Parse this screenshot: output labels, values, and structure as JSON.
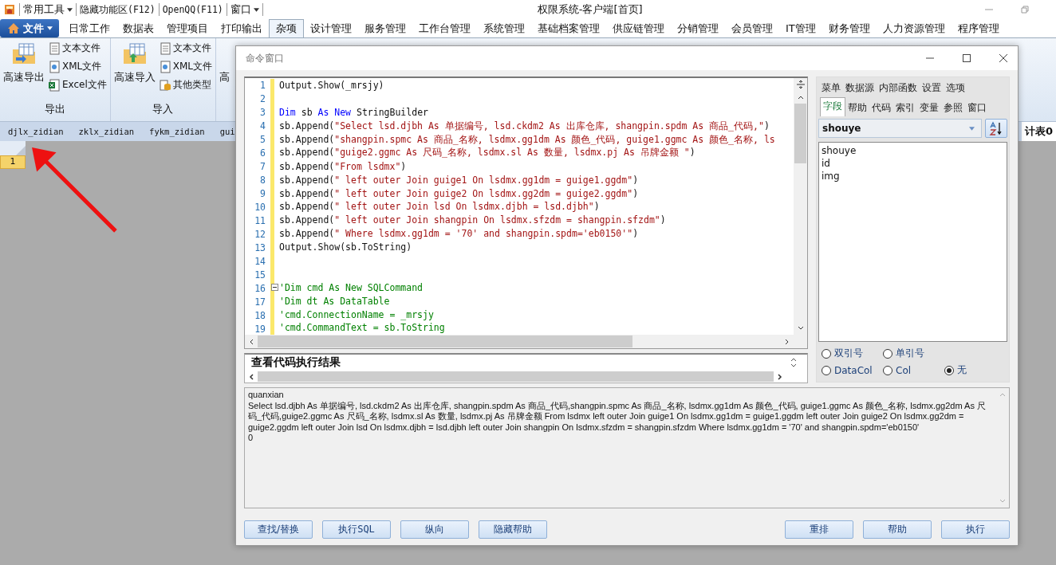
{
  "quick_bar": [
    {
      "label": "常用工具",
      "dropdown": true
    },
    {
      "label": "隐藏功能区(F12)",
      "dropdown": false
    },
    {
      "label": "OpenQQ(F11)",
      "dropdown": false
    },
    {
      "label": "窗口",
      "dropdown": true
    }
  ],
  "app_title": "权限系统-客户端[首页]",
  "file_menu": "文件",
  "menu_tabs": [
    {
      "label": "日常工作",
      "selected": false
    },
    {
      "label": "数据表",
      "selected": false
    },
    {
      "label": "管理项目",
      "selected": false
    },
    {
      "label": "打印输出",
      "selected": false
    },
    {
      "label": "杂项",
      "selected": true
    },
    {
      "label": "设计管理",
      "selected": false
    },
    {
      "label": "服务管理",
      "selected": false
    },
    {
      "label": "工作台管理",
      "selected": false
    },
    {
      "label": "系统管理",
      "selected": false
    },
    {
      "label": "基础档案管理",
      "selected": false
    },
    {
      "label": "供应链管理",
      "selected": false
    },
    {
      "label": "分销管理",
      "selected": false
    },
    {
      "label": "会员管理",
      "selected": false
    },
    {
      "label": "IT管理",
      "selected": false
    },
    {
      "label": "财务管理",
      "selected": false
    },
    {
      "label": "人力资源管理",
      "selected": false
    },
    {
      "label": "程序管理",
      "selected": false
    }
  ],
  "ribbon": [
    {
      "title": "导出",
      "large": "高速导出",
      "kind": "export",
      "small": [
        {
          "label": "文本文件",
          "kind": "text"
        },
        {
          "label": "XML文件",
          "kind": "xml"
        },
        {
          "label": "Excel文件",
          "kind": "excel"
        }
      ]
    },
    {
      "title": "导入",
      "large": "高速导入",
      "kind": "import",
      "small": [
        {
          "label": "文本文件",
          "kind": "text"
        },
        {
          "label": "XML文件",
          "kind": "xml"
        },
        {
          "label": "其他类型",
          "kind": "db"
        }
      ]
    }
  ],
  "ribbon_partial_label": "高",
  "sheet_tabs": [
    {
      "label": "djlx_zidian",
      "selected": false
    },
    {
      "label": "zklx_zidian",
      "selected": false
    },
    {
      "label": "fykm_zidian",
      "selected": false
    },
    {
      "label": "gui",
      "selected": false
    },
    {
      "label": "计表0",
      "selected": true
    }
  ],
  "grid": {
    "row_header": "1"
  },
  "dialog": {
    "title": "命令窗口",
    "code_lines": [
      {
        "n": "1",
        "kind": "code",
        "segments": [
          {
            "kind": "plain",
            "text": "Output.Show(_mrsjy)"
          }
        ]
      },
      {
        "n": "2",
        "kind": "code"
      },
      {
        "n": "3",
        "kind": "code",
        "segments": [
          {
            "kind": "keyword",
            "text": "Dim"
          },
          {
            "kind": "plain",
            "text": " sb "
          },
          {
            "kind": "keyword",
            "text": "As"
          },
          {
            "kind": "keyword",
            "text": " New"
          },
          {
            "kind": "plain",
            "text": " StringBuilder"
          }
        ]
      },
      {
        "n": "4",
        "kind": "code",
        "segments": [
          {
            "kind": "plain",
            "text": "sb.Append("
          },
          {
            "kind": "string",
            "text": "\"Select lsd.djbh As 单据编号, lsd.ckdm2 As 出库仓库, shangpin.spdm As 商品_代码,\""
          },
          {
            "kind": "plain",
            "text": ")"
          }
        ]
      },
      {
        "n": "5",
        "kind": "code",
        "segments": [
          {
            "kind": "plain",
            "text": "sb.Append("
          },
          {
            "kind": "string",
            "text": "\"shangpin.spmc As 商品_名称, lsdmx.gg1dm As 颜色_代码, guige1.ggmc As 颜色_名称, ls"
          }
        ]
      },
      {
        "n": "6",
        "kind": "code",
        "segments": [
          {
            "kind": "plain",
            "text": "sb.Append("
          },
          {
            "kind": "string",
            "text": "\"guige2.ggmc As 尺码_名称, lsdmx.sl As 数量, lsdmx.pj As 吊牌金额 \""
          },
          {
            "kind": "plain",
            "text": ")"
          }
        ]
      },
      {
        "n": "7",
        "kind": "code",
        "segments": [
          {
            "kind": "plain",
            "text": "sb.Append("
          },
          {
            "kind": "string",
            "text": "\"From lsdmx\""
          },
          {
            "kind": "plain",
            "text": ")"
          }
        ]
      },
      {
        "n": "8",
        "kind": "code",
        "segments": [
          {
            "kind": "plain",
            "text": "sb.Append("
          },
          {
            "kind": "string",
            "text": "\" left outer Join guige1 On lsdmx.gg1dm = guige1.ggdm\""
          },
          {
            "kind": "plain",
            "text": ")"
          }
        ]
      },
      {
        "n": "9",
        "kind": "code",
        "segments": [
          {
            "kind": "plain",
            "text": "sb.Append("
          },
          {
            "kind": "string",
            "text": "\" left outer Join guige2 On lsdmx.gg2dm = guige2.ggdm\""
          },
          {
            "kind": "plain",
            "text": ")"
          }
        ]
      },
      {
        "n": "10",
        "kind": "code",
        "segments": [
          {
            "kind": "plain",
            "text": "sb.Append("
          },
          {
            "kind": "string",
            "text": "\" left outer Join lsd On lsdmx.djbh = lsd.djbh\""
          },
          {
            "kind": "plain",
            "text": ")"
          }
        ]
      },
      {
        "n": "11",
        "kind": "code",
        "segments": [
          {
            "kind": "plain",
            "text": "sb.Append("
          },
          {
            "kind": "string",
            "text": "\" left outer Join shangpin On lsdmx.sfzdm = shangpin.sfzdm\""
          },
          {
            "kind": "plain",
            "text": ")"
          }
        ]
      },
      {
        "n": "12",
        "kind": "code",
        "segments": [
          {
            "kind": "plain",
            "text": "sb.Append("
          },
          {
            "kind": "string",
            "text": "\" Where lsdmx.gg1dm = '70' and shangpin.spdm='eb0150'\""
          },
          {
            "kind": "plain",
            "text": ")"
          }
        ]
      },
      {
        "n": "13",
        "kind": "code",
        "segments": [
          {
            "kind": "plain",
            "text": "Output.Show(sb.ToString)"
          }
        ]
      },
      {
        "n": "14",
        "kind": "code"
      },
      {
        "n": "15",
        "kind": "code"
      },
      {
        "n": "16",
        "kind": "fold",
        "segments": [
          {
            "kind": "comment",
            "text": "'Dim cmd As New SQLCommand"
          }
        ]
      },
      {
        "n": "17",
        "kind": "code",
        "segments": [
          {
            "kind": "comment",
            "text": "'Dim dt As DataTable"
          }
        ]
      },
      {
        "n": "18",
        "kind": "code",
        "segments": [
          {
            "kind": "comment",
            "text": "'cmd.ConnectionName = _mrsjy"
          }
        ]
      },
      {
        "n": "19",
        "kind": "code",
        "segments": [
          {
            "kind": "comment",
            "text": "'cmd.CommandText = sb.ToString"
          }
        ]
      }
    ],
    "result_header": "查看代码执行结果",
    "output_lines": [
      "quanxian",
      "Select lsd.djbh As 单据编号, lsd.ckdm2 As 出库仓库, shangpin.spdm As 商品_代码,shangpin.spmc As 商品_名称, lsdmx.gg1dm As 颜色_代码, guige1.ggmc As 颜色_名称, lsdmx.gg2dm As 尺码_代码,guige2.ggmc As 尺码_名称, lsdmx.sl As 数量, lsdmx.pj As 吊牌金额 From lsdmx left outer Join guige1 On lsdmx.gg1dm = guige1.ggdm left outer Join guige2 On lsdmx.gg2dm = guige2.ggdm left outer Join lsd On lsdmx.djbh = lsd.djbh left outer Join shangpin On lsdmx.sfzdm = shangpin.sfzdm Where lsdmx.gg1dm = '70' and shangpin.spdm='eb0150'",
      "0"
    ],
    "buttons_left": [
      "查找/替换",
      "执行SQL",
      "纵向",
      "隐藏帮助"
    ],
    "buttons_right": [
      "重排",
      "帮助",
      "执行"
    ],
    "panel": {
      "menu": [
        "菜单",
        "数据源",
        "内部函数",
        "设置",
        "选项"
      ],
      "tabs": [
        {
          "label": "字段",
          "selected": true
        },
        {
          "label": "帮助",
          "selected": false
        },
        {
          "label": "代码",
          "selected": false
        },
        {
          "label": "索引",
          "selected": false
        },
        {
          "label": "变量",
          "selected": false
        },
        {
          "label": "参照",
          "selected": false
        },
        {
          "label": "窗口",
          "selected": false
        }
      ],
      "combo": "shouye",
      "fields": [
        "shouye",
        "id",
        "img"
      ],
      "radios": [
        {
          "label": "双引号",
          "selected": false
        },
        {
          "label": "单引号",
          "selected": false
        },
        {
          "label": "DataCol",
          "selected": false
        },
        {
          "label": "Col",
          "selected": false
        },
        {
          "label": "无",
          "selected": true
        }
      ]
    }
  }
}
